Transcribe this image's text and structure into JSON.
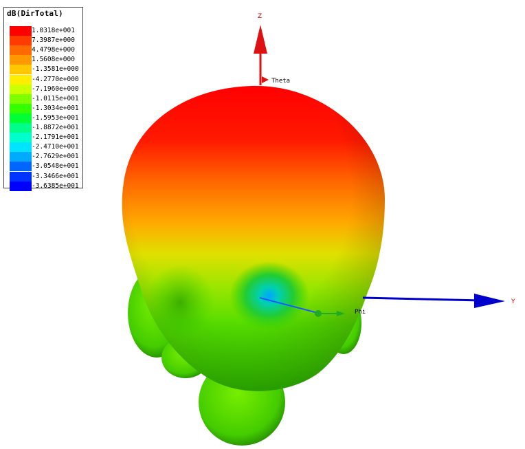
{
  "legend": {
    "title": "dB(DirTotal)",
    "entries": [
      {
        "value": "1.0318e+001",
        "color": "#ff0000"
      },
      {
        "value": "7.3987e+000",
        "color": "#ff3b00"
      },
      {
        "value": "4.4798e+000",
        "color": "#ff6a00"
      },
      {
        "value": "1.5608e+000",
        "color": "#ff9900"
      },
      {
        "value": "-1.3581e+000",
        "color": "#ffc800"
      },
      {
        "value": "-4.2770e+000",
        "color": "#ffee00"
      },
      {
        "value": "-7.1960e+000",
        "color": "#ccff00"
      },
      {
        "value": "-1.0115e+001",
        "color": "#7dff00"
      },
      {
        "value": "-1.3034e+001",
        "color": "#33ff00"
      },
      {
        "value": "-1.5953e+001",
        "color": "#00ff33"
      },
      {
        "value": "-1.8872e+001",
        "color": "#00ff88"
      },
      {
        "value": "-2.1791e+001",
        "color": "#00ffcc"
      },
      {
        "value": "-2.4710e+001",
        "color": "#00e5ff"
      },
      {
        "value": "-2.7629e+001",
        "color": "#00aaff"
      },
      {
        "value": "-3.0548e+001",
        "color": "#0066ff"
      },
      {
        "value": "-3.3466e+001",
        "color": "#0033ff"
      },
      {
        "value": "-3.6385e+001",
        "color": "#0000ff"
      }
    ]
  },
  "axes": {
    "z_label": "Z",
    "y_label": "Y",
    "theta_label": "Theta",
    "phi_label": "Phi",
    "z_color": "#dd1111",
    "y_color": "#0000cc",
    "theta_color": "#dd1111",
    "phi_color": "#22aa22"
  }
}
